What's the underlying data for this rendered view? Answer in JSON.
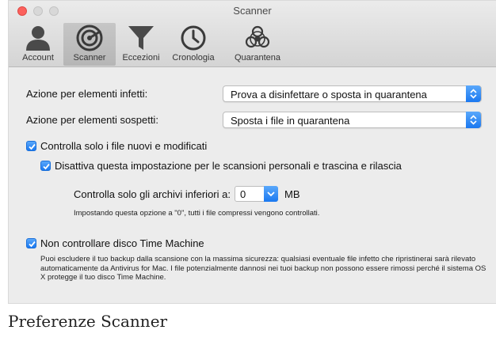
{
  "window": {
    "title": "Scanner"
  },
  "toolbar": {
    "items": [
      {
        "label": "Account",
        "icon": "account-icon",
        "selected": false
      },
      {
        "label": "Scanner",
        "icon": "scanner-icon",
        "selected": true
      },
      {
        "label": "Eccezioni",
        "icon": "funnel-icon",
        "selected": false
      },
      {
        "label": "Cronologia",
        "icon": "clock-icon",
        "selected": false
      },
      {
        "label": "Quarantena",
        "icon": "biohazard-icon",
        "selected": false
      }
    ]
  },
  "settings": {
    "infected_label": "Azione per elementi infetti:",
    "infected_value": "Prova a disinfettare o sposta in quarantena",
    "suspicious_label": "Azione per elementi sospetti:",
    "suspicious_value": "Sposta i file in quarantena",
    "check_new_label": "Controlla solo i file nuovi e modificati",
    "check_new_checked": true,
    "disable_setting_label": "Disattiva questa impostazione per le scansioni personali e trascina e rilascia",
    "disable_setting_checked": true,
    "archives_label": "Controlla solo gli archivi inferiori a:",
    "archives_value": "0",
    "archives_unit": "MB",
    "archives_note": "Impostando questa opzione a \"0\", tutti i file compressi vengono controllati.",
    "time_machine_label": "Non controllare disco Time Machine",
    "time_machine_checked": true,
    "time_machine_note": "Puoi escludere il tuo backup dalla scansione con la massima sicurezza: qualsiasi eventuale file infetto che ripristinerai sarà rilevato automaticamente da Antivirus for Mac. I file potenzialmente dannosi nei tuoi backup non possono essere rimossi perché il sistema OS X protegge il tuo disco Time Machine."
  },
  "caption": "Preferenze Scanner",
  "colors": {
    "accent": "#1a78f0",
    "close": "#fc605c",
    "window_bg": "#ececec"
  }
}
